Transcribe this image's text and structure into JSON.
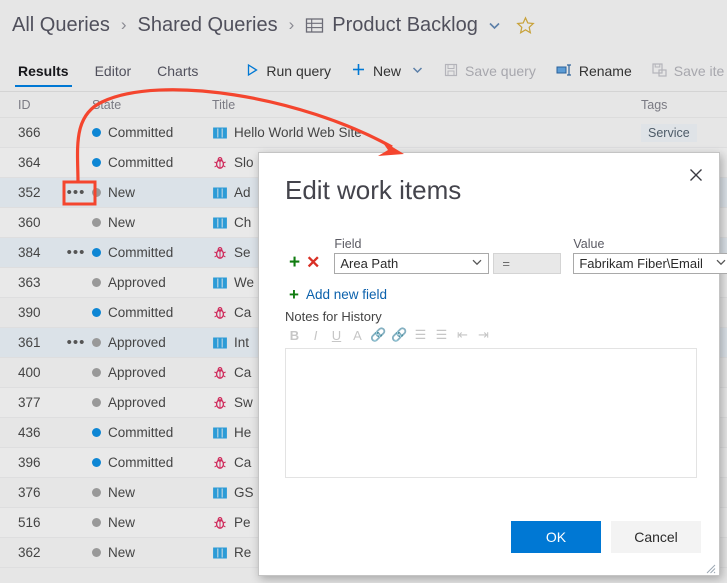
{
  "breadcrumb": {
    "items": [
      "All Queries",
      "Shared Queries",
      "Product Backlog"
    ],
    "separator": "›",
    "grid_icon": "table-icon",
    "chevron_icon": "chevron-down-icon",
    "favorite_icon": "star-icon"
  },
  "toolbar": {
    "tabs": [
      {
        "label": "Results",
        "active": true
      },
      {
        "label": "Editor",
        "active": false
      },
      {
        "label": "Charts",
        "active": false
      }
    ],
    "actions": [
      {
        "label": "Run query",
        "icon": "play-icon",
        "disabled": false,
        "chevron": false
      },
      {
        "label": "New",
        "icon": "plus-icon",
        "disabled": false,
        "chevron": true
      },
      {
        "label": "Save query",
        "icon": "save-icon",
        "disabled": true,
        "chevron": false
      },
      {
        "label": "Rename",
        "icon": "rename-icon",
        "disabled": false,
        "chevron": false
      },
      {
        "label": "Save ite",
        "icon": "save-items-icon",
        "disabled": true,
        "chevron": false
      }
    ]
  },
  "grid": {
    "columns": [
      "ID",
      "State",
      "Title",
      "Tags"
    ],
    "colors": {
      "committed": "#0e86d4",
      "new": "#999999",
      "approved": "#999999"
    },
    "rows": [
      {
        "id": "366",
        "dots": "",
        "state": "Committed",
        "state_color": "#0e86d4",
        "icon": "backlog-item-icon",
        "title": "Hello World Web Site",
        "tag": "Service",
        "selected": false,
        "alt": false
      },
      {
        "id": "364",
        "dots": "",
        "state": "Committed",
        "state_color": "#0e86d4",
        "icon": "bug-icon",
        "title": "Slo",
        "tag": "",
        "selected": false,
        "alt": true
      },
      {
        "id": "352",
        "dots": "•••",
        "state": "New",
        "state_color": "#999999",
        "icon": "backlog-item-icon",
        "title": "Ad",
        "tag": "",
        "selected": true,
        "alt": false
      },
      {
        "id": "360",
        "dots": "",
        "state": "New",
        "state_color": "#999999",
        "icon": "backlog-item-icon",
        "title": "Ch",
        "tag": "",
        "selected": false,
        "alt": true
      },
      {
        "id": "384",
        "dots": "•••",
        "state": "Committed",
        "state_color": "#0e86d4",
        "icon": "bug-icon",
        "title": "Se",
        "tag": "",
        "selected": true,
        "alt": false
      },
      {
        "id": "363",
        "dots": "",
        "state": "Approved",
        "state_color": "#999999",
        "icon": "backlog-item-icon",
        "title": "We",
        "tag": "",
        "selected": false,
        "alt": true
      },
      {
        "id": "390",
        "dots": "",
        "state": "Committed",
        "state_color": "#0e86d4",
        "icon": "bug-icon",
        "title": "Ca",
        "tag": "",
        "selected": false,
        "alt": false
      },
      {
        "id": "361",
        "dots": "•••",
        "state": "Approved",
        "state_color": "#999999",
        "icon": "backlog-item-icon",
        "title": "Int",
        "tag": "",
        "selected": true,
        "alt": true
      },
      {
        "id": "400",
        "dots": "",
        "state": "Approved",
        "state_color": "#999999",
        "icon": "bug-icon",
        "title": "Ca",
        "tag": "",
        "selected": false,
        "alt": false
      },
      {
        "id": "377",
        "dots": "",
        "state": "Approved",
        "state_color": "#999999",
        "icon": "bug-icon",
        "title": "Sw",
        "tag": "",
        "selected": false,
        "alt": true
      },
      {
        "id": "436",
        "dots": "",
        "state": "Committed",
        "state_color": "#0e86d4",
        "icon": "backlog-item-icon",
        "title": "He",
        "tag": "",
        "selected": false,
        "alt": false
      },
      {
        "id": "396",
        "dots": "",
        "state": "Committed",
        "state_color": "#0e86d4",
        "icon": "bug-icon",
        "title": "Ca",
        "tag": "",
        "selected": false,
        "alt": true
      },
      {
        "id": "376",
        "dots": "",
        "state": "New",
        "state_color": "#999999",
        "icon": "backlog-item-icon",
        "title": "GS",
        "tag": "",
        "selected": false,
        "alt": false
      },
      {
        "id": "516",
        "dots": "",
        "state": "New",
        "state_color": "#999999",
        "icon": "bug-icon",
        "title": "Pe",
        "tag": "",
        "selected": false,
        "alt": true
      },
      {
        "id": "362",
        "dots": "",
        "state": "New",
        "state_color": "#999999",
        "icon": "backlog-item-icon",
        "title": "Re",
        "tag": "",
        "selected": false,
        "alt": false
      }
    ]
  },
  "annotation": {
    "color": "#f4452e",
    "highlight_target": "row-352-context-menu-button",
    "arrow_from": "context-menu-button",
    "arrow_to": "edit-work-items-dialog"
  },
  "dialog": {
    "title": "Edit work items",
    "close_icon": "close-icon",
    "field_row": {
      "add_icon": "plus-icon",
      "remove_icon": "remove-icon",
      "field_label": "Field",
      "field_value": "Area Path",
      "operator": "=",
      "value_label": "Value",
      "value_value": "Fabrikam Fiber\\Email",
      "dropdown_icon": "chevron-down-icon"
    },
    "add_new_field": "Add new field",
    "notes_label": "Notes for History",
    "notes_value": "",
    "rte_buttons": [
      {
        "name": "bold-icon",
        "glyph": "B"
      },
      {
        "name": "italic-icon",
        "glyph": "I"
      },
      {
        "name": "underline-icon",
        "glyph": "U"
      },
      {
        "name": "clear-format-icon",
        "glyph": "A"
      },
      {
        "name": "link-icon",
        "glyph": "🔗"
      },
      {
        "name": "unlink-icon",
        "glyph": "🔗"
      },
      {
        "name": "bulleted-list-icon",
        "glyph": "☰"
      },
      {
        "name": "numbered-list-icon",
        "glyph": "☰"
      },
      {
        "name": "decrease-indent-icon",
        "glyph": "⇤"
      },
      {
        "name": "increase-indent-icon",
        "glyph": "⇥"
      }
    ],
    "ok_label": "OK",
    "cancel_label": "Cancel",
    "ok_color": "#0078d4",
    "resize_grip_icon": "resize-grip-icon"
  }
}
